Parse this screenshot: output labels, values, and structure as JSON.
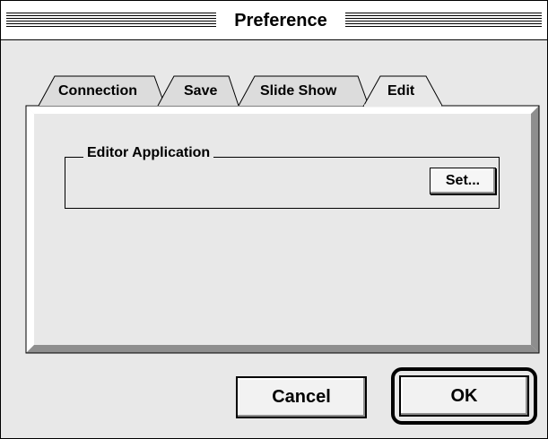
{
  "window": {
    "title": "Preference"
  },
  "tabs": [
    {
      "label": "Connection",
      "selected": false
    },
    {
      "label": "Save",
      "selected": false
    },
    {
      "label": "Slide Show",
      "selected": false
    },
    {
      "label": "Edit",
      "selected": true
    }
  ],
  "edit_panel": {
    "group_label": "Editor Application",
    "set_button": "Set..."
  },
  "footer": {
    "cancel_label": "Cancel",
    "ok_label": "OK"
  },
  "colors": {
    "panel": "#e8e8e8",
    "panel_shadow": "#8e8e8e",
    "border": "#000000"
  }
}
